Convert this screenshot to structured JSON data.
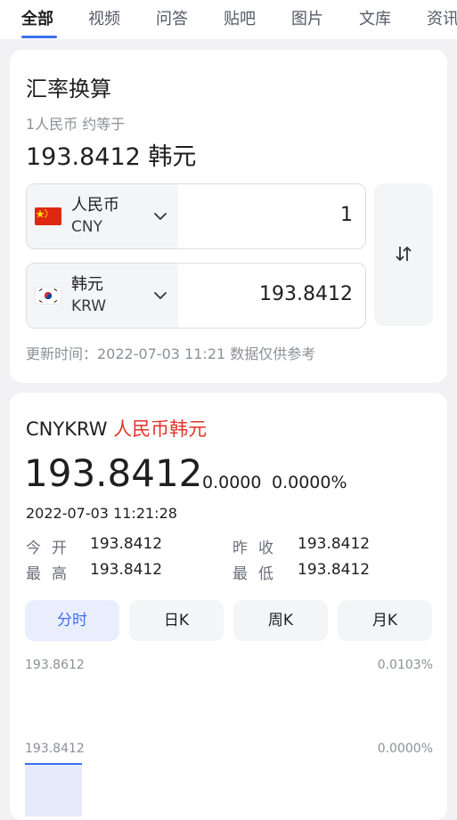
{
  "nav": {
    "tabs": [
      "全部",
      "视频",
      "问答",
      "贴吧",
      "图片",
      "文库",
      "资讯"
    ],
    "active": "全部"
  },
  "converter": {
    "title": "汇率换算",
    "subtitle": "1人民币 约等于",
    "result": "193.8412 韩元",
    "from": {
      "name": "人民币",
      "code": "CNY",
      "amount": "1",
      "flag": "china-flag"
    },
    "to": {
      "name": "韩元",
      "code": "KRW",
      "amount": "193.8412",
      "flag": "south-korea-flag"
    },
    "update_note": "更新时间：2022-07-03 11:21 数据仅供参考"
  },
  "quote": {
    "symbol": "CNYKRW",
    "name": "人民币韩元",
    "price": "193.8412",
    "change": "0.0000",
    "change_pct": "0.0000%",
    "time": "2022-07-03 11:21:28",
    "stats": {
      "open_label": "今开",
      "open": "193.8412",
      "prev_close_label": "昨收",
      "prev_close": "193.8412",
      "high_label": "最高",
      "high": "193.8412",
      "low_label": "最低",
      "low": "193.8412"
    },
    "periods": [
      "分时",
      "日K",
      "周K",
      "月K"
    ],
    "active_period": "分时"
  },
  "chart_data": {
    "type": "area",
    "y_labels_left": [
      "193.8612",
      "193.8412"
    ],
    "y_labels_right": [
      "0.0103%",
      "0.0000%"
    ],
    "values": [
      193.8412
    ],
    "accent_color": "#3a6ff2",
    "fill_color": "#e6ebfb"
  },
  "colors": {
    "accent": "#3a6ff2",
    "name_red": "#e0352b"
  }
}
